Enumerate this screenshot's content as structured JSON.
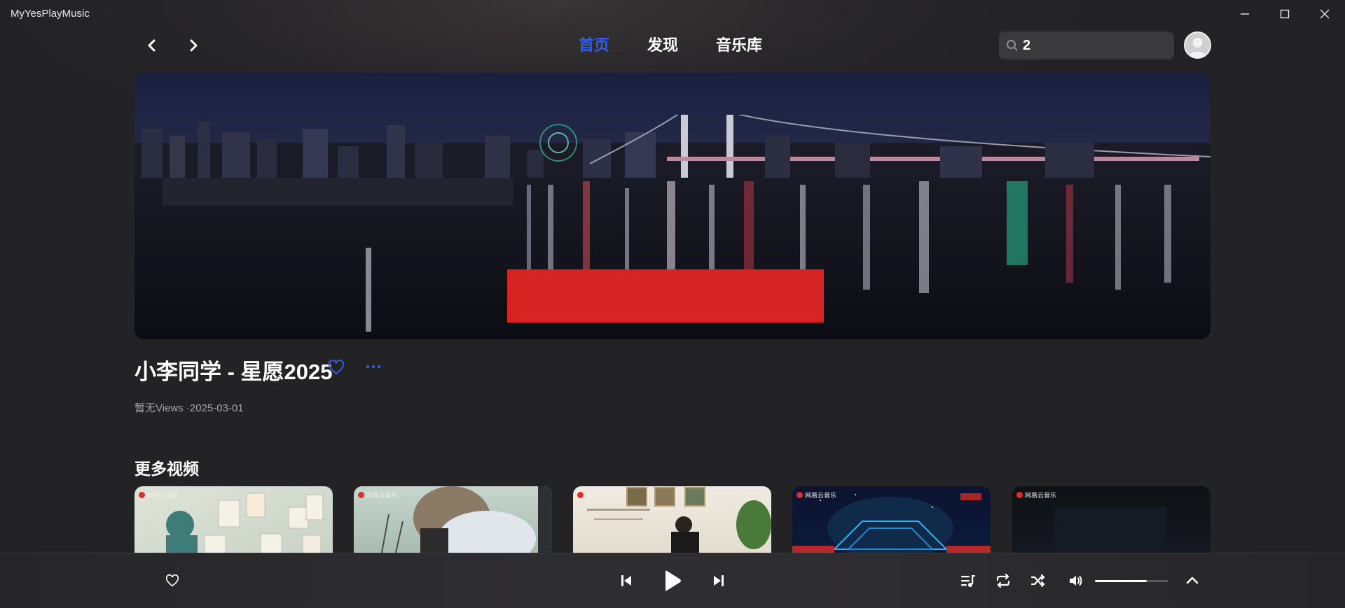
{
  "window": {
    "title": "MyYesPlayMusic"
  },
  "nav": {
    "links": [
      "首页",
      "发现",
      "音乐库"
    ],
    "active": 0,
    "search_value": "2"
  },
  "video": {
    "title": "小李同学 - 星愿2025",
    "meta": "暂无Views ·2025-03-01"
  },
  "more_videos": {
    "heading": "更多视频",
    "badge": "网易云音乐",
    "count": 5
  },
  "player": {
    "volume": 0.7,
    "liked": false
  },
  "colors": {
    "accent": "#335eea",
    "background": "#232325"
  },
  "icons": [
    "back-icon",
    "forward-icon",
    "minimize-icon",
    "maximize-icon",
    "close-icon",
    "search-icon",
    "heart-icon",
    "more-icon",
    "previous-icon",
    "play-icon",
    "next-icon",
    "playlist-icon",
    "repeat-icon",
    "shuffle-icon",
    "volume-icon",
    "expand-up-icon"
  ]
}
